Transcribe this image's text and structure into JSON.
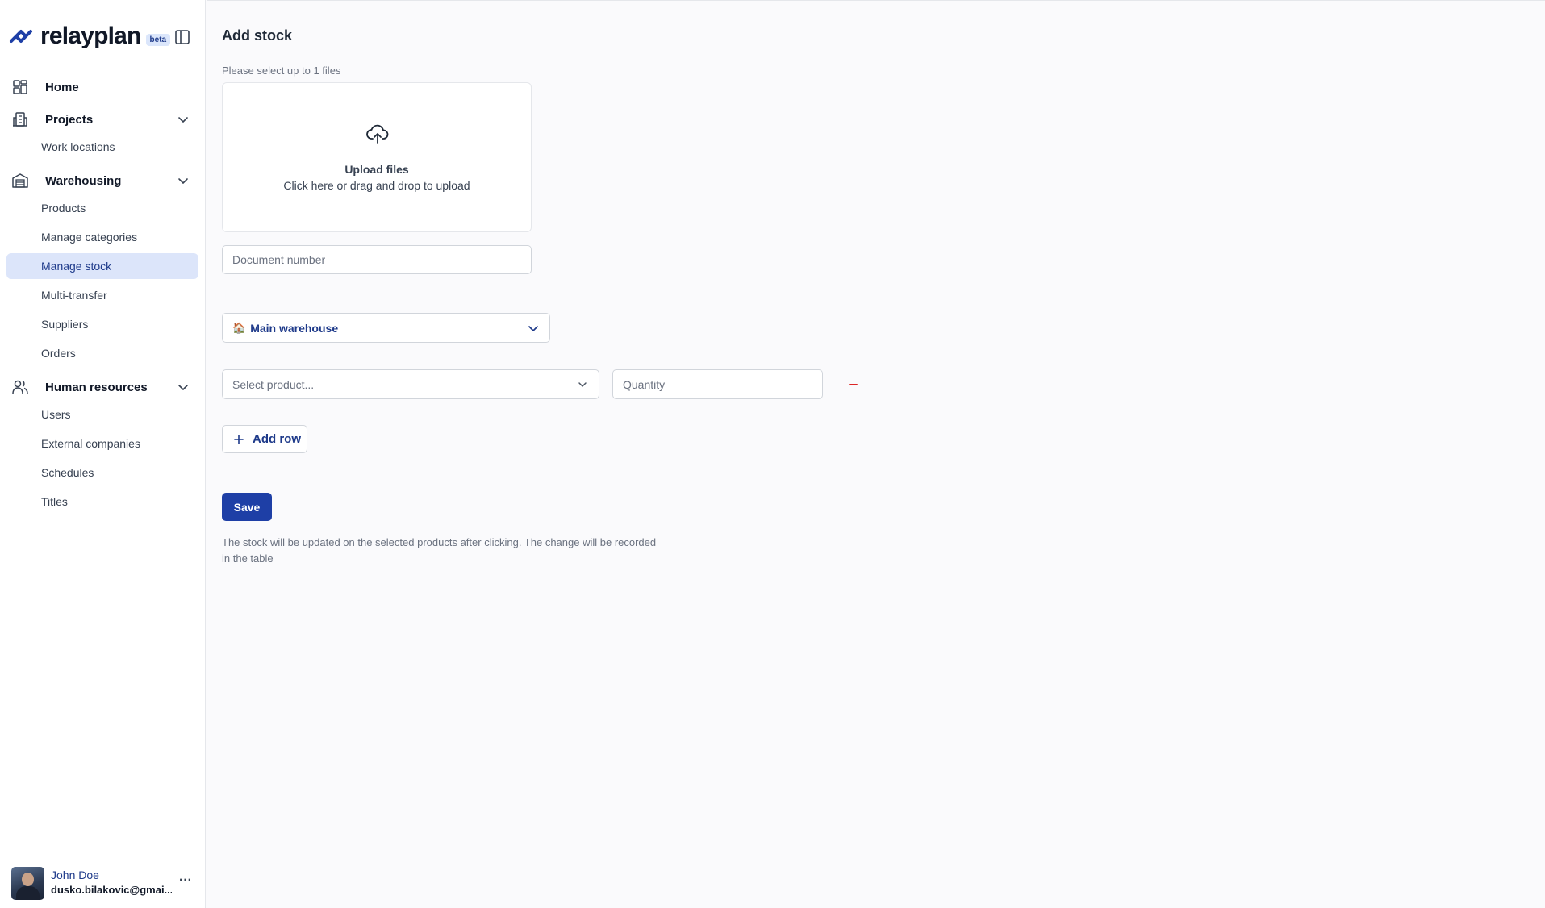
{
  "brand": {
    "name": "relayplan",
    "badge": "beta"
  },
  "sidebar": {
    "sections": [
      {
        "label": "Home",
        "icon": "grid-icon",
        "items": []
      },
      {
        "label": "Projects",
        "icon": "building-icon",
        "items": [
          {
            "label": "Work locations"
          }
        ]
      },
      {
        "label": "Warehousing",
        "icon": "warehouse-icon",
        "items": [
          {
            "label": "Products"
          },
          {
            "label": "Manage categories"
          },
          {
            "label": "Manage stock",
            "active": true
          },
          {
            "label": "Multi-transfer"
          },
          {
            "label": "Suppliers"
          },
          {
            "label": "Orders"
          }
        ]
      },
      {
        "label": "Human resources",
        "icon": "users-icon",
        "items": [
          {
            "label": "Users"
          },
          {
            "label": "External companies"
          },
          {
            "label": "Schedules"
          },
          {
            "label": "Titles"
          }
        ]
      }
    ]
  },
  "user": {
    "name": "John Doe",
    "email": "dusko.bilakovic@gmai...",
    "menu": "···"
  },
  "main": {
    "title": "Add stock",
    "upload": {
      "hint": "Please select up to 1 files",
      "title": "Upload files",
      "subtitle": "Click here or drag and drop to upload"
    },
    "document_number": {
      "placeholder": "Document number",
      "value": ""
    },
    "warehouse": {
      "icon": "🏠",
      "label": "Main warehouse"
    },
    "row": {
      "product_placeholder": "Select product...",
      "quantity_placeholder": "Quantity"
    },
    "add_row_label": "Add row",
    "save_label": "Save",
    "note": "The stock will be updated on the selected products after clicking. The change will be recorded in the table"
  },
  "colors": {
    "accent": "#1e3fa6",
    "active_bg": "#dce5fa",
    "danger": "#dc2626",
    "brand_text": "#1e3a8a"
  }
}
